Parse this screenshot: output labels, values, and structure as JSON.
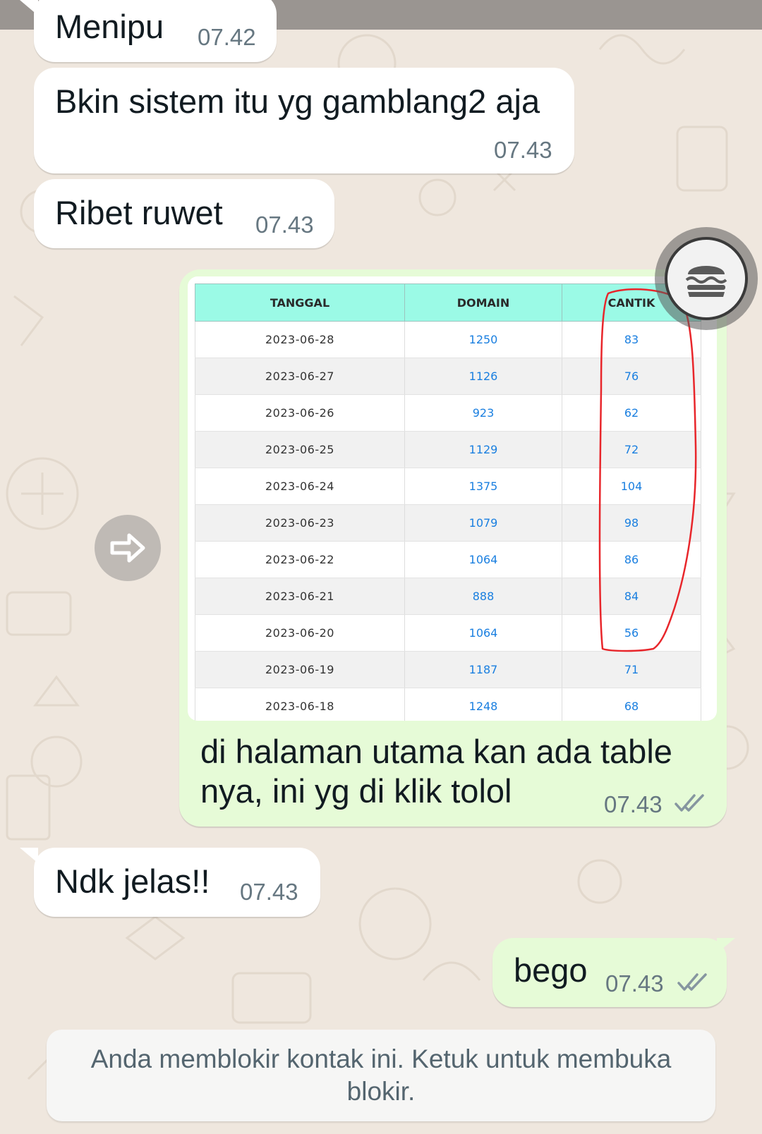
{
  "messages": [
    {
      "text": "Menipu",
      "time": "07.42"
    },
    {
      "text": "Bkin sistem itu yg gamblang2 aja",
      "time": "07.43"
    },
    {
      "text": "Ribet ruwet",
      "time": "07.43"
    },
    {
      "text": "di halaman utama kan ada table nya, ini yg di klik tolol",
      "time": "07.43"
    },
    {
      "text": "Ndk jelas!!",
      "time": "07.43"
    },
    {
      "text": "bego",
      "time": "07.43"
    }
  ],
  "image_table": {
    "headers": [
      "TANGGAL",
      "DOMAIN",
      "CANTIK"
    ],
    "rows": [
      [
        "2023-06-28",
        "1250",
        "83"
      ],
      [
        "2023-06-27",
        "1126",
        "76"
      ],
      [
        "2023-06-26",
        "923",
        "62"
      ],
      [
        "2023-06-25",
        "1129",
        "72"
      ],
      [
        "2023-06-24",
        "1375",
        "104"
      ],
      [
        "2023-06-23",
        "1079",
        "98"
      ],
      [
        "2023-06-22",
        "1064",
        "86"
      ],
      [
        "2023-06-21",
        "888",
        "84"
      ],
      [
        "2023-06-20",
        "1064",
        "56"
      ],
      [
        "2023-06-19",
        "1187",
        "71"
      ],
      [
        "2023-06-18",
        "1248",
        "68"
      ]
    ],
    "annotation_color": "#e8262b"
  },
  "icons": {
    "forward": "forward-arrow-icon",
    "floating_app": "burger-icon",
    "read_receipt": "double-check-icon"
  },
  "blocked_notice": "Anda memblokir kontak ini. Ketuk untuk membuka blokir.",
  "colors": {
    "chat_background": "#efe7de",
    "incoming_bubble": "#ffffff",
    "outgoing_bubble": "#e6fbd7",
    "table_header": "#9bfae6",
    "table_link": "#1a7fe0",
    "read_tick": "#8696a0"
  }
}
